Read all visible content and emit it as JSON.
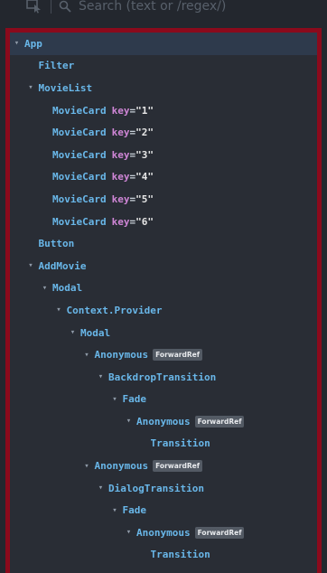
{
  "toolbar": {
    "search_placeholder": "Search (text or /regex/)"
  },
  "tree": {
    "rows": [
      {
        "name": "App",
        "expanded": true,
        "depth": 0
      },
      {
        "name": "Filter",
        "expanded": null,
        "depth": 1
      },
      {
        "name": "MovieList",
        "expanded": true,
        "depth": 1
      },
      {
        "name": "MovieCard",
        "expanded": null,
        "depth": 2,
        "prop_key": "key",
        "prop_value": "\"1\""
      },
      {
        "name": "MovieCard",
        "expanded": null,
        "depth": 2,
        "prop_key": "key",
        "prop_value": "\"2\""
      },
      {
        "name": "MovieCard",
        "expanded": null,
        "depth": 2,
        "prop_key": "key",
        "prop_value": "\"3\""
      },
      {
        "name": "MovieCard",
        "expanded": null,
        "depth": 2,
        "prop_key": "key",
        "prop_value": "\"4\""
      },
      {
        "name": "MovieCard",
        "expanded": null,
        "depth": 2,
        "prop_key": "key",
        "prop_value": "\"5\""
      },
      {
        "name": "MovieCard",
        "expanded": null,
        "depth": 2,
        "prop_key": "key",
        "prop_value": "\"6\""
      },
      {
        "name": "Button",
        "expanded": null,
        "depth": 1
      },
      {
        "name": "AddMovie",
        "expanded": true,
        "depth": 1
      },
      {
        "name": "Modal",
        "expanded": true,
        "depth": 2
      },
      {
        "name": "Context.Provider",
        "expanded": true,
        "depth": 3
      },
      {
        "name": "Modal",
        "expanded": true,
        "depth": 4
      },
      {
        "name": "Anonymous",
        "expanded": true,
        "depth": 5,
        "badge": "ForwardRef"
      },
      {
        "name": "BackdropTransition",
        "expanded": true,
        "depth": 6
      },
      {
        "name": "Fade",
        "expanded": true,
        "depth": 7
      },
      {
        "name": "Anonymous",
        "expanded": true,
        "depth": 8,
        "badge": "ForwardRef"
      },
      {
        "name": "Transition",
        "expanded": null,
        "depth": 9
      },
      {
        "name": "Anonymous",
        "expanded": true,
        "depth": 5,
        "badge": "ForwardRef"
      },
      {
        "name": "DialogTransition",
        "expanded": true,
        "depth": 6
      },
      {
        "name": "Fade",
        "expanded": true,
        "depth": 7
      },
      {
        "name": "Anonymous",
        "expanded": true,
        "depth": 8,
        "badge": "ForwardRef"
      },
      {
        "name": "Transition",
        "expanded": null,
        "depth": 9
      }
    ]
  },
  "colors": {
    "component": "#69b7e9",
    "prop_key": "#cf86d6",
    "badge_bg": "#535a64",
    "highlight_border": "#8b0a1c",
    "panel_bg": "#292d35"
  }
}
